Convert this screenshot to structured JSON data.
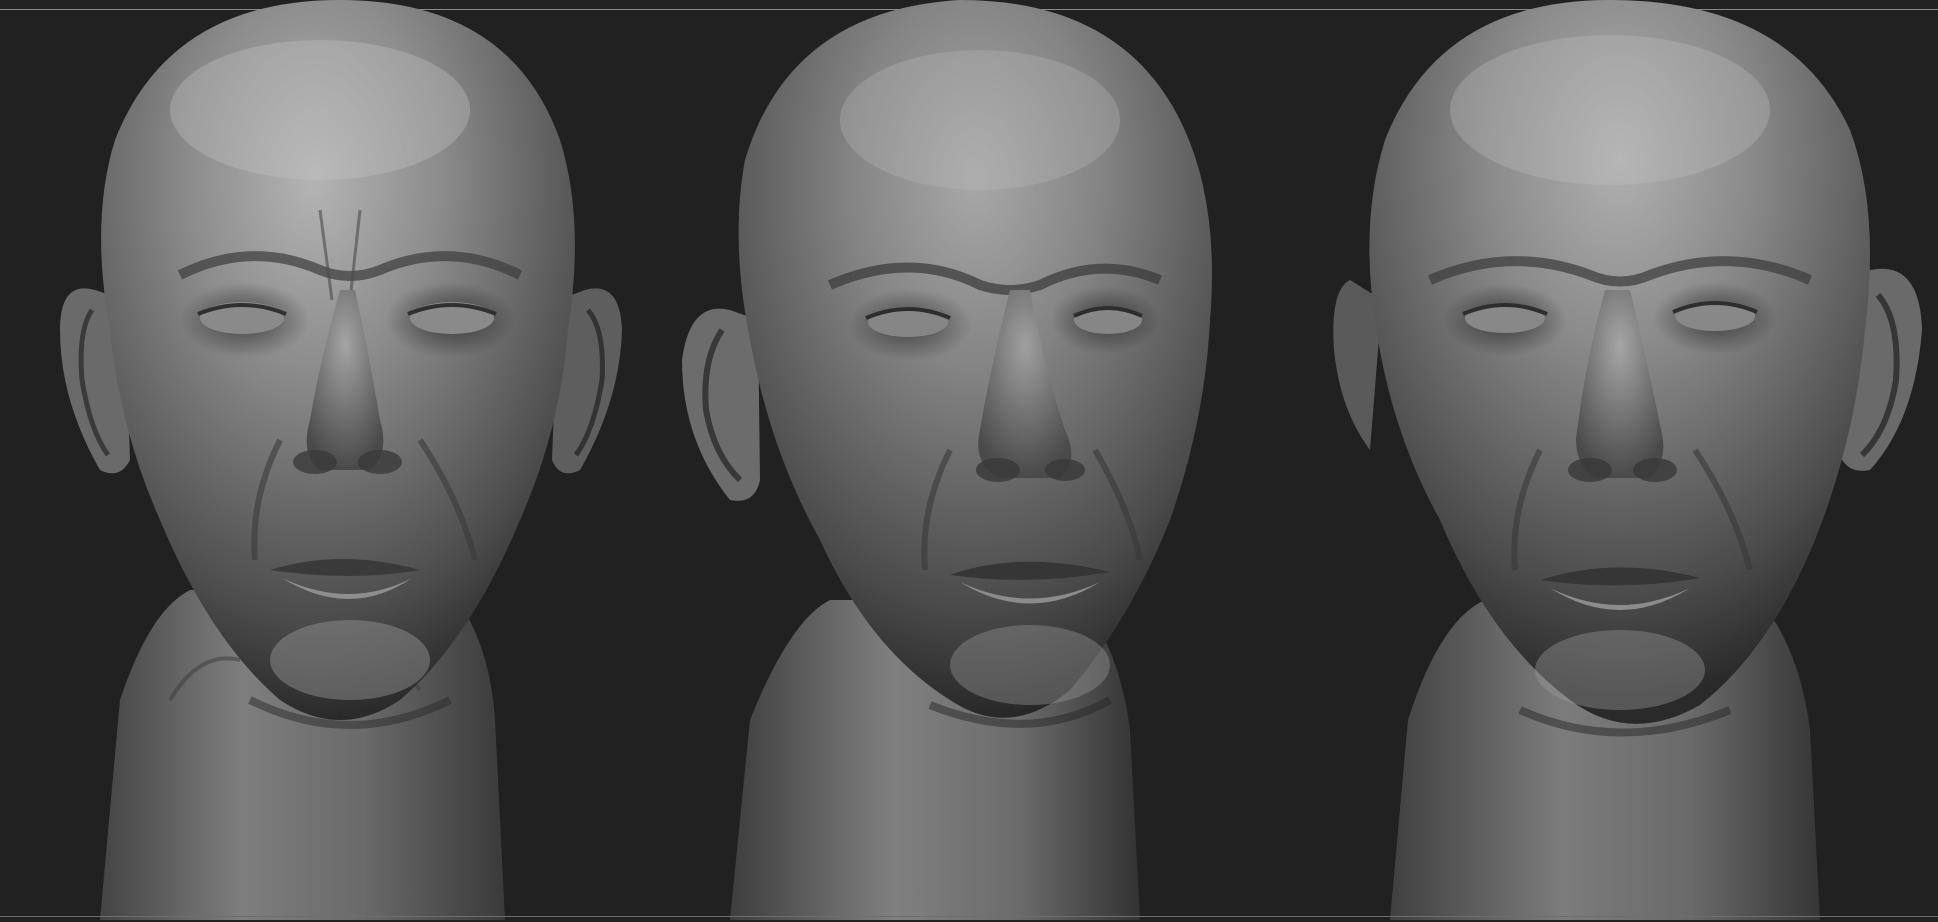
{
  "scene": {
    "background_color": "#212121",
    "material_color": "#7a7a7a",
    "frame_line_color": "#8a8a8a"
  },
  "renders": [
    {
      "view": "front"
    },
    {
      "view": "three-quarter"
    },
    {
      "view": "front-alt"
    }
  ]
}
